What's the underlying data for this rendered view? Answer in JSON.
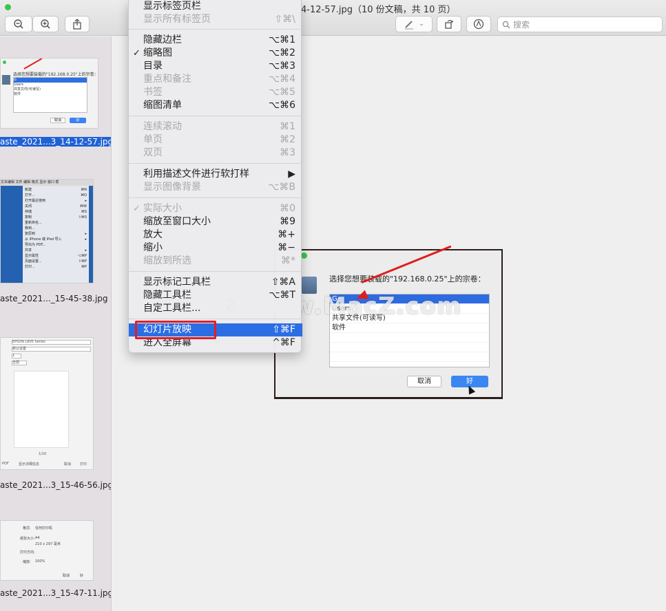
{
  "window": {
    "title": "4-12-57.jpg（10 份文稿，共 10 页）",
    "search_placeholder": "搜索"
  },
  "sidebar": {
    "thumbs": [
      {
        "caption": "aste_2021...3_14-12-57.jpg",
        "selected": true,
        "heading": "选择您想要装载的\"192.168.0.25\"上的宗卷：",
        "items": [
          "G",
          "Users",
          "共享文件(可读写)",
          "软件"
        ],
        "cancel": "取消",
        "ok": "好"
      },
      {
        "caption": "aste_2021..._15-45-38.jpg",
        "selected": false,
        "menubar": "文本编辑  文件  编辑  格式  显示  窗口  帮",
        "menu_items": [
          "新建",
          "打开...",
          "打开最近使用",
          "关闭",
          "存储",
          "复制",
          "重新命名...",
          "移到...",
          "复原到",
          "从 iPhone 或 iPad 导入",
          "导出为 PDF...",
          "共享",
          "显示属性",
          "页面设置...",
          "打印..."
        ],
        "menu_shortcuts": [
          "⌘N",
          "⌘O",
          "▸",
          "⌘W",
          "⌘S",
          "⇧⌘S",
          "",
          "",
          "▸",
          "▸",
          "",
          "▸",
          "⌥⌘P",
          "⇧⌘P",
          "⌘P"
        ]
      },
      {
        "caption": "aste_2021...3_15-46-56.jpg",
        "selected": false,
        "printer": "EPSON L805 Series",
        "preset": "默认设置",
        "copies": "1",
        "pages": "全部",
        "pdf": "PDF",
        "details": "显示详细信息",
        "cancel": "取消",
        "print": "打印",
        "page_counter": "1/10"
      },
      {
        "caption": "aste_2021...3_15-47-11.jpg",
        "selected": false,
        "format_label": "格式:",
        "format_value": "任何打印机",
        "paper_label": "纸张大小:",
        "paper_value": "A4",
        "paper_dims": "210 x 297 毫米",
        "orient_label": "打印方向:",
        "scale_label": "缩放:",
        "scale_value": "100%",
        "cancel": "取消",
        "ok": "好"
      }
    ]
  },
  "menu": {
    "items": [
      {
        "label": "显示标签页栏",
        "shortcut": "",
        "disabled": false
      },
      {
        "label": "显示所有标签页",
        "shortcut": "⇧⌘\\",
        "disabled": true
      },
      {
        "label": "隐藏边栏",
        "shortcut": "⌥⌘1",
        "disabled": false
      },
      {
        "label": "缩略图",
        "shortcut": "⌥⌘2",
        "disabled": false,
        "checked": true
      },
      {
        "label": "目录",
        "shortcut": "⌥⌘3",
        "disabled": false
      },
      {
        "label": "重点和备注",
        "shortcut": "⌥⌘4",
        "disabled": true
      },
      {
        "label": "书签",
        "shortcut": "⌥⌘5",
        "disabled": true
      },
      {
        "label": "缩图清单",
        "shortcut": "⌥⌘6",
        "disabled": false
      },
      {
        "label": "连续滚动",
        "shortcut": "⌘1",
        "disabled": true
      },
      {
        "label": "单页",
        "shortcut": "⌘2",
        "disabled": true
      },
      {
        "label": "双页",
        "shortcut": "⌘3",
        "disabled": true
      },
      {
        "label": "利用描述文件进行软打样",
        "shortcut": "▶",
        "disabled": false
      },
      {
        "label": "显示图像背景",
        "shortcut": "⌥⌘B",
        "disabled": true
      },
      {
        "label": "实际大小",
        "shortcut": "⌘0",
        "disabled": true,
        "checked": true
      },
      {
        "label": "缩放至窗口大小",
        "shortcut": "⌘9",
        "disabled": false
      },
      {
        "label": "放大",
        "shortcut": "⌘+",
        "disabled": false
      },
      {
        "label": "缩小",
        "shortcut": "⌘−",
        "disabled": false
      },
      {
        "label": "缩放到所选",
        "shortcut": "⌘*",
        "disabled": true
      },
      {
        "label": "显示标记工具栏",
        "shortcut": "⇧⌘A",
        "disabled": false
      },
      {
        "label": "隐藏工具栏",
        "shortcut": "⌥⌘T",
        "disabled": false
      },
      {
        "label": "自定工具栏...",
        "shortcut": "",
        "disabled": false
      },
      {
        "label": "幻灯片放映",
        "shortcut": "⇧⌘F",
        "disabled": false,
        "highlighted": true
      },
      {
        "label": "进入全屏幕",
        "shortcut": "^⌘F",
        "disabled": false
      }
    ]
  },
  "document": {
    "prompt": "选择您想要装载的\"192.168.0.25\"上的宗卷：",
    "volumes": [
      "G",
      "Users",
      "共享文件(可读写)",
      "软件"
    ],
    "cancel": "取消",
    "ok": "好"
  },
  "watermark": {
    "logo_letter": "Z",
    "text": "www.MacZ.com"
  },
  "colors": {
    "accent": "#2b6ee4",
    "annotation_red": "#e51c23"
  }
}
